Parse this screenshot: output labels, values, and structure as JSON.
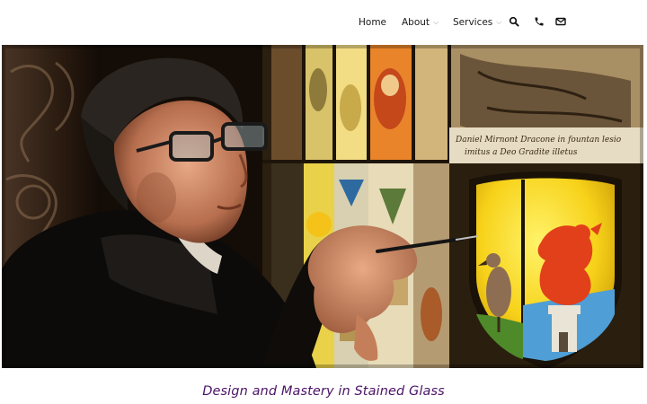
{
  "nav": {
    "items": [
      {
        "label": "Home",
        "has_dropdown": false
      },
      {
        "label": "About",
        "has_dropdown": true
      },
      {
        "label": "Services",
        "has_dropdown": true
      }
    ],
    "icons": [
      "search-icon",
      "phone-icon",
      "envelope-icon"
    ],
    "dropdown_glyph": "⌵"
  },
  "hero": {
    "glass_inscription": [
      "Daniel Mirnont Dracone in fountan lesio",
      "imitus a Deo Gradite illetus"
    ]
  },
  "tagline": "Design and Mastery in Stained Glass",
  "colors": {
    "tagline": "#4a1466",
    "nav_text": "#1a1a1a",
    "chevron": "#9a9a9a"
  }
}
